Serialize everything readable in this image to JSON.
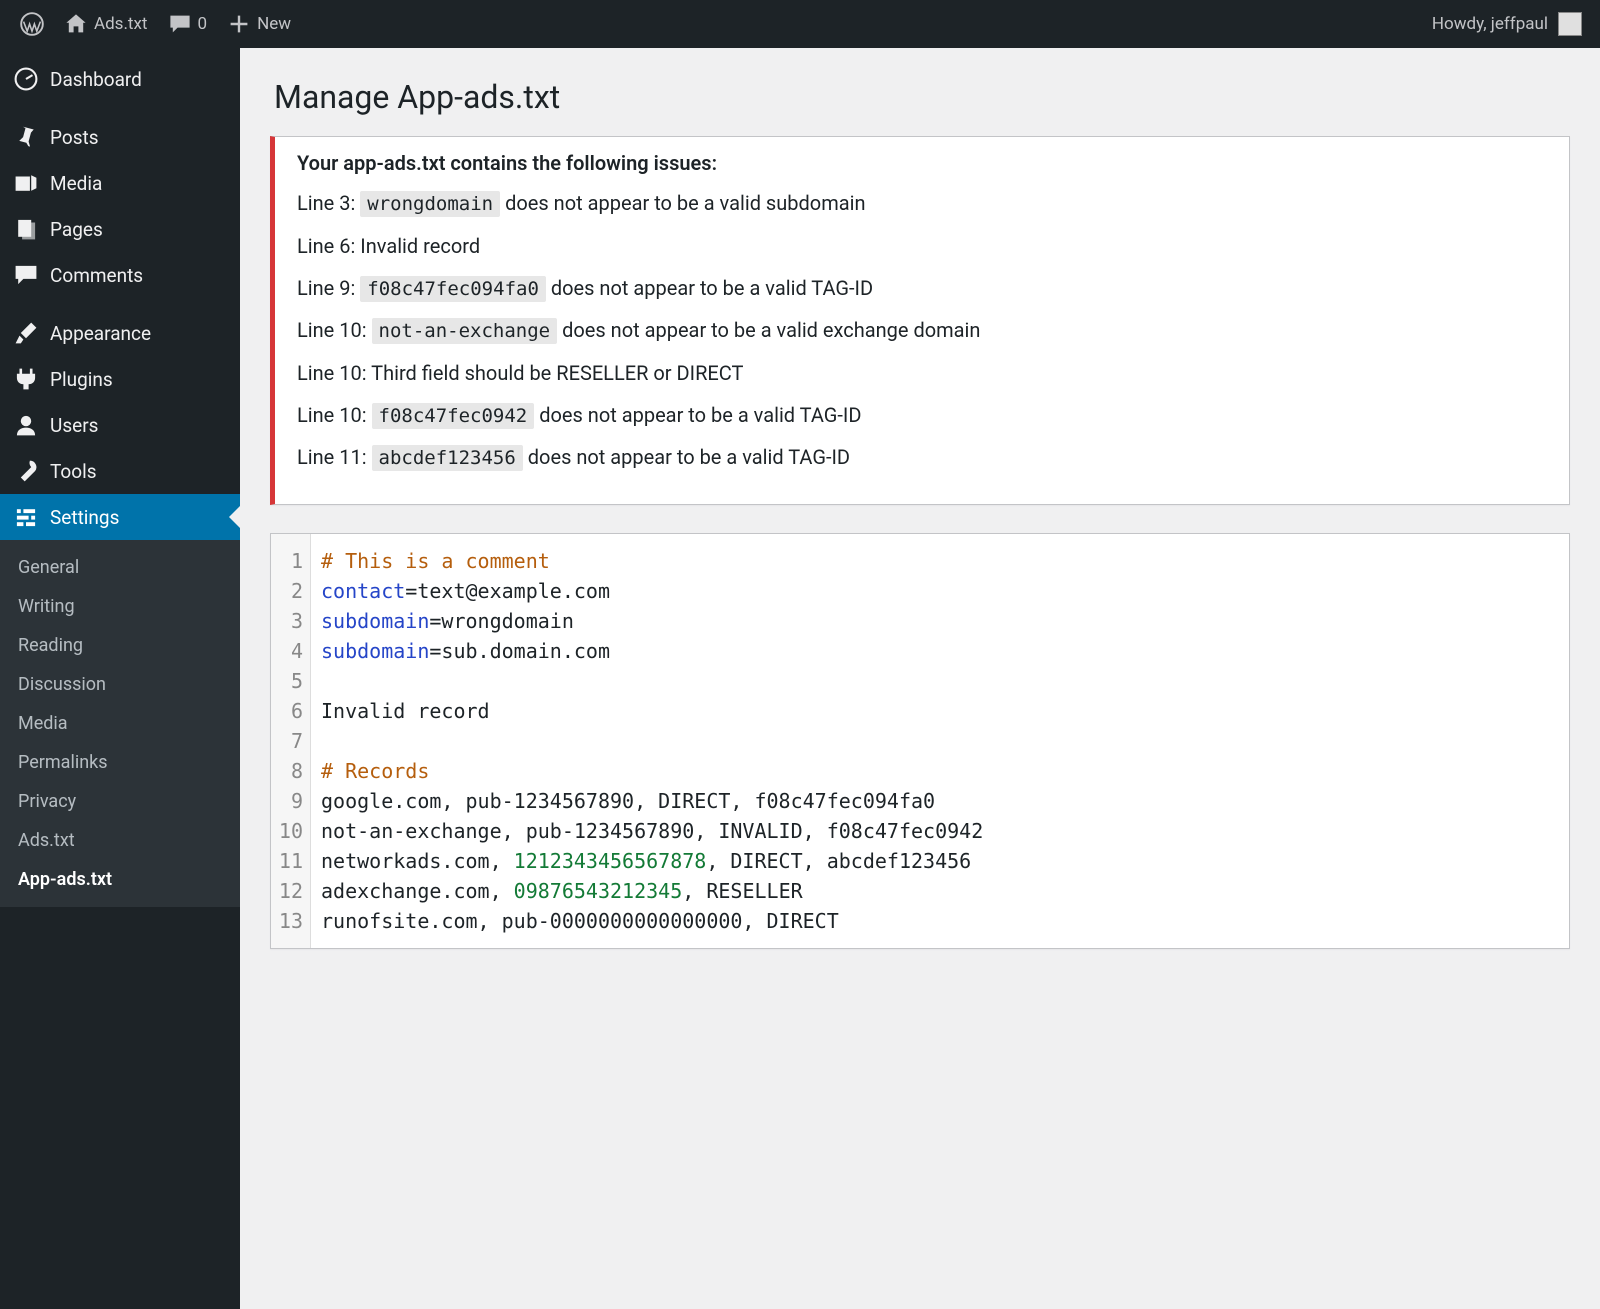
{
  "adminbar": {
    "site_name": "Ads.txt",
    "comments_count": "0",
    "new_label": "New",
    "greeting": "Howdy, jeffpaul"
  },
  "sidebar": {
    "dashboard": "Dashboard",
    "posts": "Posts",
    "media": "Media",
    "pages": "Pages",
    "comments": "Comments",
    "appearance": "Appearance",
    "plugins": "Plugins",
    "users": "Users",
    "tools": "Tools",
    "settings": "Settings"
  },
  "settings_submenu": [
    "General",
    "Writing",
    "Reading",
    "Discussion",
    "Media",
    "Permalinks",
    "Privacy",
    "Ads.txt",
    "App-ads.txt"
  ],
  "settings_current_index": 8,
  "page_title": "Manage App-ads.txt",
  "notice_head": "Your app-ads.txt contains the following issues:",
  "issues": [
    {
      "prefix": "Line 3: ",
      "code": "wrongdomain",
      "suffix": " does not appear to be a valid subdomain"
    },
    {
      "prefix": "Line 6: Invalid record",
      "code": null,
      "suffix": ""
    },
    {
      "prefix": "Line 9: ",
      "code": "f08c47fec094fa0",
      "suffix": " does not appear to be a valid TAG-ID"
    },
    {
      "prefix": "Line 10: ",
      "code": "not-an-exchange",
      "suffix": " does not appear to be a valid exchange domain"
    },
    {
      "prefix": "Line 10: Third field should be RESELLER or DIRECT",
      "code": null,
      "suffix": ""
    },
    {
      "prefix": "Line 10: ",
      "code": "f08c47fec0942",
      "suffix": " does not appear to be a valid TAG-ID"
    },
    {
      "prefix": "Line 11: ",
      "code": "abcdef123456",
      "suffix": " does not appear to be a valid TAG-ID"
    }
  ],
  "code_lines": [
    [
      {
        "cls": "tok-comment",
        "t": "# This is a comment"
      }
    ],
    [
      {
        "cls": "tok-key",
        "t": "contact"
      },
      {
        "cls": "",
        "t": "=text@example.com"
      }
    ],
    [
      {
        "cls": "tok-key",
        "t": "subdomain"
      },
      {
        "cls": "",
        "t": "=wrongdomain"
      }
    ],
    [
      {
        "cls": "tok-key",
        "t": "subdomain"
      },
      {
        "cls": "",
        "t": "=sub.domain.com"
      }
    ],
    [],
    [
      {
        "cls": "",
        "t": "Invalid record"
      }
    ],
    [],
    [
      {
        "cls": "tok-comment",
        "t": "# Records"
      }
    ],
    [
      {
        "cls": "",
        "t": "google.com, pub-1234567890, DIRECT, f08c47fec094fa0"
      }
    ],
    [
      {
        "cls": "",
        "t": "not-an-exchange, pub-1234567890, INVALID, f08c47fec0942"
      }
    ],
    [
      {
        "cls": "",
        "t": "networkads.com, "
      },
      {
        "cls": "tok-num",
        "t": "1212343456567878"
      },
      {
        "cls": "",
        "t": ", DIRECT, abcdef123456"
      }
    ],
    [
      {
        "cls": "",
        "t": "adexchange.com, "
      },
      {
        "cls": "tok-num",
        "t": "09876543212345"
      },
      {
        "cls": "",
        "t": ", RESELLER"
      }
    ],
    [
      {
        "cls": "",
        "t": "runofsite.com, pub-0000000000000000, DIRECT"
      }
    ]
  ]
}
